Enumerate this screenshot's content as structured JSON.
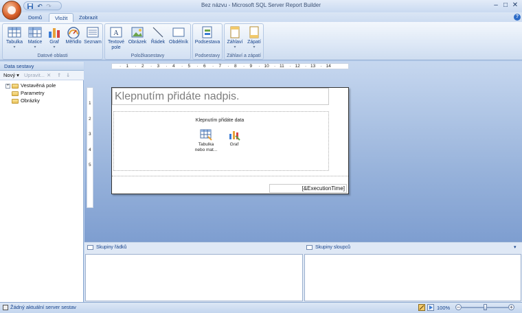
{
  "window": {
    "title": "Bez názvu - Microsoft SQL Server Report Builder",
    "minimize": "–",
    "maximize": "□",
    "close": "✕"
  },
  "qat": {
    "save_icon": "save-icon",
    "undo_icon": "undo-icon",
    "redo_icon": "redo-icon"
  },
  "tabs": [
    {
      "label": "Domů"
    },
    {
      "label": "Vložit"
    },
    {
      "label": "Zobrazit"
    }
  ],
  "help": "?",
  "ribbon": {
    "groups": [
      {
        "label": "Datové oblasti",
        "buttons": [
          {
            "label": "Tabulka",
            "has_dropdown": true
          },
          {
            "label": "Matice",
            "has_dropdown": true
          },
          {
            "label": "Graf",
            "has_dropdown": true
          },
          {
            "label": "Měřidlo",
            "has_dropdown": false
          },
          {
            "label": "Seznam",
            "has_dropdown": false
          }
        ]
      },
      {
        "label": "Položkasestavy",
        "buttons": [
          {
            "label": "Textové pole"
          },
          {
            "label": "Obrázek"
          },
          {
            "label": "Řádek"
          },
          {
            "label": "Obdélník"
          }
        ]
      },
      {
        "label": "Podsestavy",
        "buttons": [
          {
            "label": "Podsestava"
          }
        ]
      },
      {
        "label": "Záhlaví a zápatí",
        "buttons": [
          {
            "label": "Záhlaví",
            "has_dropdown": true
          },
          {
            "label": "Zápatí",
            "has_dropdown": true
          }
        ]
      }
    ],
    "dropdown_glyph": "▾"
  },
  "data_pane": {
    "header": "Data sestavy",
    "toolbar": {
      "new": "Nový ▾",
      "edit": "Upravit...",
      "delete": "✕",
      "up": "⇑",
      "down": "⇓"
    },
    "tree": [
      {
        "label": "Vestavěná pole",
        "expandable": true,
        "expander": "+"
      },
      {
        "label": "Parametry",
        "expandable": false
      },
      {
        "label": "Obrázky",
        "expandable": false
      }
    ]
  },
  "ruler": {
    "h": [
      "1",
      "2",
      "3",
      "4",
      "5",
      "6",
      "7",
      "8",
      "9",
      "10",
      "11",
      "12",
      "13",
      "14"
    ],
    "v": [
      "1",
      "2",
      "3",
      "4",
      "5"
    ]
  },
  "report": {
    "title_placeholder": "Klepnutím přidáte nadpis.",
    "body_prompt": "Klepnutím přidáte data",
    "wizards": [
      {
        "label": "Tabulka nebo mat...",
        "icon": "table-wizard-icon"
      },
      {
        "label": "Graf",
        "icon": "chart-wizard-icon"
      }
    ],
    "footer_expression": "[&ExecutionTime]"
  },
  "grouping": {
    "row_groups": "Skupiny řádků",
    "column_groups": "Skupiny sloupců",
    "collapse": "▾"
  },
  "status": {
    "text": "Žádný aktuální server sestav",
    "zoom": "100%",
    "zoom_level_percent": 100,
    "minus": "–",
    "plus": "+"
  },
  "colors": {
    "ribbon_text": "#15428b",
    "canvas_bg": "#98b3db",
    "office_button": "#d8602a"
  }
}
